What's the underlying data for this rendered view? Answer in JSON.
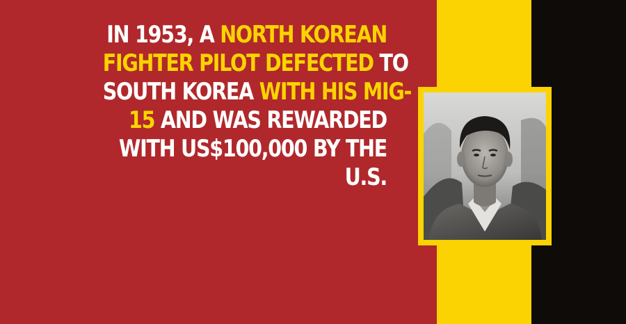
{
  "colors": {
    "red": "#b0282b",
    "yellow": "#fcd302",
    "black": "#0f0b08",
    "white": "#ffffff"
  },
  "fact": {
    "lines": [
      {
        "white1": "IN 1953, A ",
        "yellow": "NORTH KOREAN",
        "white2": ""
      },
      {
        "white1": "",
        "yellow": "FIGHTER PILOT DEFECTED",
        "white2": " TO"
      },
      {
        "white1": "SOUTH KOREA ",
        "yellow": "WITH HIS MIG-",
        "white2": ""
      },
      {
        "white1": "",
        "yellow": "15",
        "white2": " AND WAS REWARDED"
      },
      {
        "white1": "WITH US$100,000 BY THE",
        "yellow": "",
        "white2": ""
      },
      {
        "white1": "U.S.",
        "yellow": "",
        "white2": ""
      }
    ]
  },
  "photo": {
    "subject": "black-and-white portrait of a man"
  }
}
